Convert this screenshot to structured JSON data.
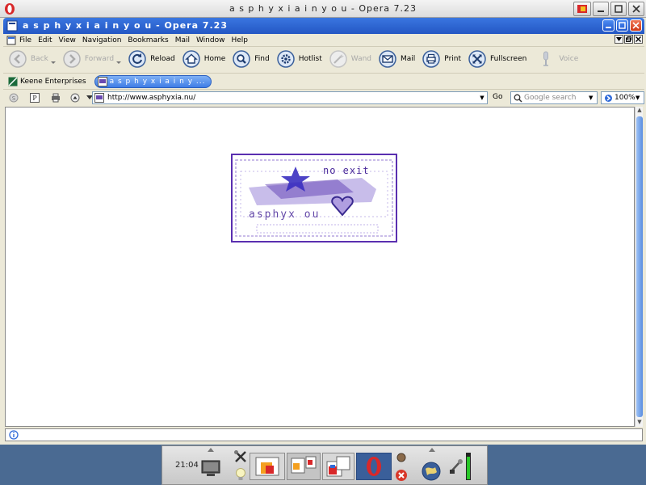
{
  "wm": {
    "title": "a s p h y x i a i n y o u - Opera 7.23"
  },
  "document": {
    "title": "a s p h y x i a i n y o u - Opera 7.23"
  },
  "menu": {
    "items": [
      "File",
      "Edit",
      "View",
      "Navigation",
      "Bookmarks",
      "Mail",
      "Window",
      "Help"
    ]
  },
  "toolbar": {
    "back": "Back",
    "forward": "Forward",
    "reload": "Reload",
    "home": "Home",
    "find": "Find",
    "hotlist": "Hotlist",
    "wand": "Wand",
    "mail": "Mail",
    "print": "Print",
    "fullscreen": "Fullscreen",
    "voice": "Voice"
  },
  "pagebar": {
    "tabs": [
      {
        "label": "Keene Enterprises"
      },
      {
        "label": "a s p h y x i a i n y ..."
      }
    ]
  },
  "addressbar": {
    "url": "http://www.asphyxia.nu/",
    "go": "Go",
    "search_placeholder": "Google search",
    "zoom": "100%"
  },
  "page": {
    "logo_top_text": "no exit",
    "logo_main_text": "asphyx  ou"
  },
  "taskbar": {
    "clock": "21:04"
  },
  "colors": {
    "titlebar_blue": "#2f6ad9",
    "close_red": "#e0522c",
    "logo_purple": "#5a2fb0"
  }
}
